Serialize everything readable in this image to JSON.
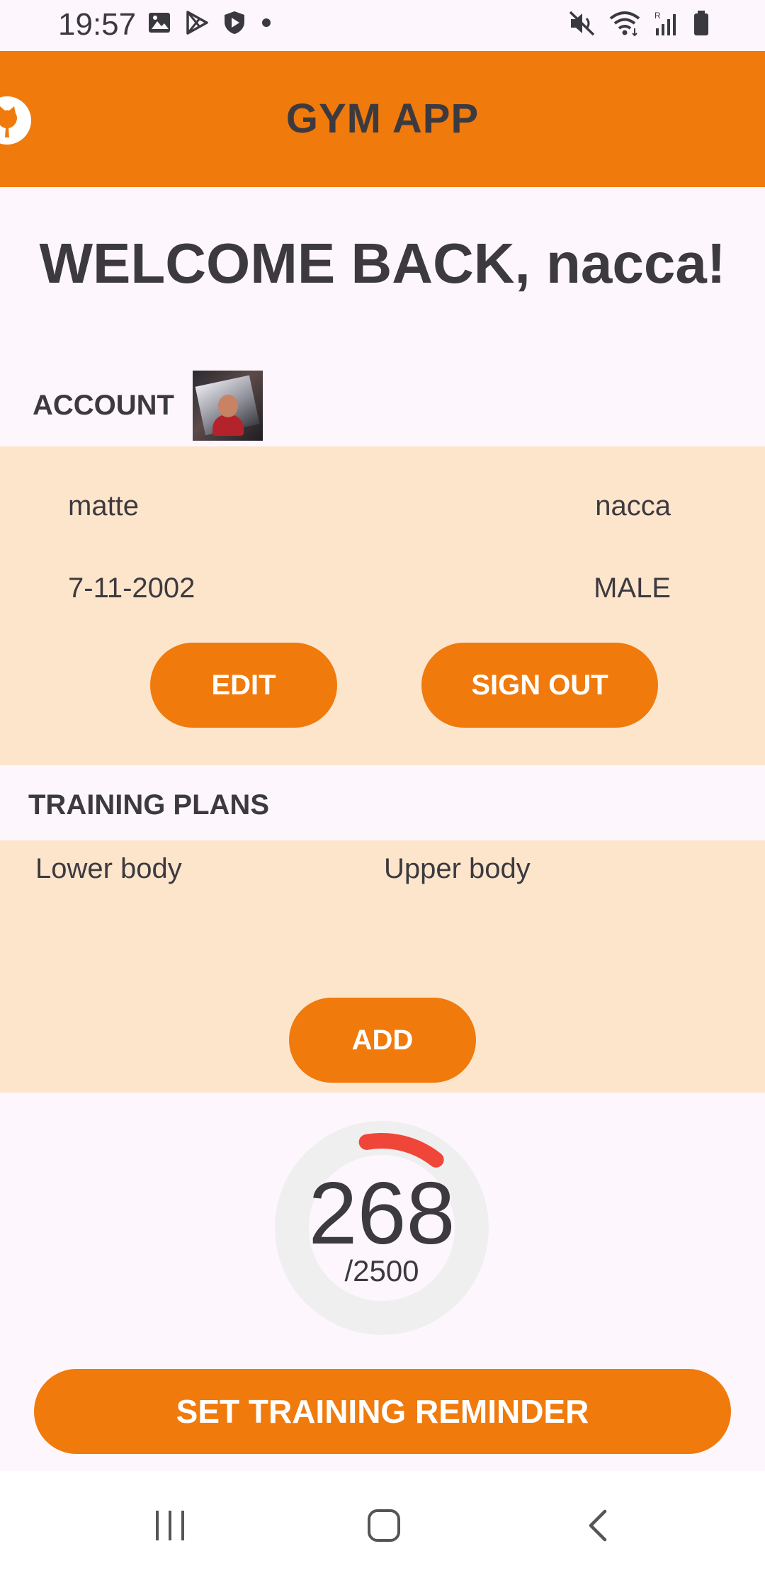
{
  "status_bar": {
    "time": "19:57",
    "left_icons": [
      "image-icon",
      "play-store-icon",
      "shield-icon",
      "dot-icon"
    ],
    "right_icons": [
      "mute-icon",
      "wifi-icon",
      "signal-icon",
      "battery-icon"
    ]
  },
  "app_bar": {
    "title": "GYM APP",
    "icon": "github-icon"
  },
  "welcome": "WELCOME BACK, nacca!",
  "account": {
    "label": "ACCOUNT",
    "first_name": "matte",
    "last_name": "nacca",
    "birth_date": "7-11-2002",
    "gender": "MALE",
    "edit_label": "EDIT",
    "sign_out_label": "SIGN OUT"
  },
  "training_plans": {
    "label": "TRAINING PLANS",
    "items": [
      "Lower body",
      "Upper body"
    ],
    "add_label": "ADD"
  },
  "progress": {
    "value": "268",
    "goal": "/2500",
    "fraction": 0.107,
    "track_color": "#efefef",
    "fill_color": "#f0463a"
  },
  "reminder_label": "SET TRAINING REMINDER",
  "nav": {
    "icons": [
      "recent-apps-icon",
      "home-icon",
      "back-icon"
    ]
  },
  "colors": {
    "accent": "#f07a0c",
    "panel": "#fde5cc",
    "background": "#fdf7fd"
  }
}
